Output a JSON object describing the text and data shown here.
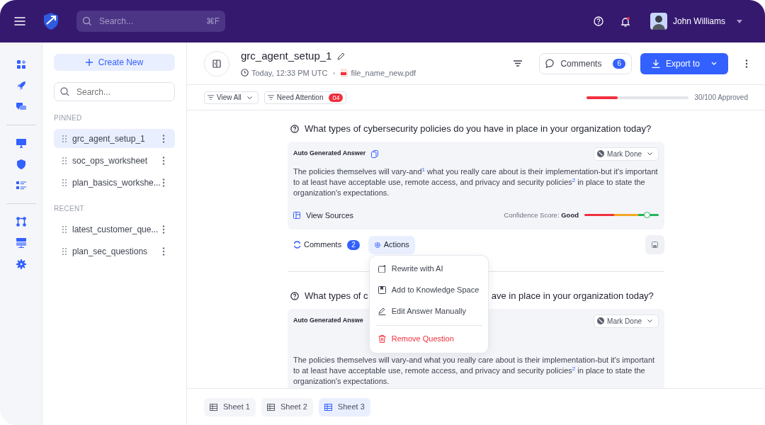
{
  "topbar": {
    "search": {
      "placeholder": "Search...",
      "shortcut": "⌘F"
    },
    "notifications": {
      "unread": true
    },
    "user": {
      "name": "John Williams"
    }
  },
  "sidebar": {
    "create_button": "Create New",
    "search": {
      "placeholder": "Search..."
    },
    "sections": [
      {
        "title": "PINNED",
        "items": [
          {
            "label": "grc_agent_setup_1",
            "selected": true
          },
          {
            "label": "soc_ops_worksheet",
            "selected": false
          },
          {
            "label": "plan_basics_workshe...",
            "selected": false
          }
        ]
      },
      {
        "title": "RECENT",
        "items": [
          {
            "label": "latest_customer_que...",
            "selected": false
          },
          {
            "label": "plan_sec_questions",
            "selected": false
          }
        ]
      }
    ]
  },
  "document": {
    "title": "grc_agent_setup_1",
    "timestamp": "Today, 12:33 PM UTC",
    "file_name": "file_name_new.pdf",
    "comments_button": {
      "label": "Comments",
      "count": "6"
    },
    "export_button": "Export to"
  },
  "filters": [
    {
      "kind": "dropdown",
      "label": "View All"
    },
    {
      "kind": "count",
      "label": "Need Attention",
      "badge": "04"
    }
  ],
  "progress": {
    "level": 0.3,
    "label": "30/100 Approved"
  },
  "questions": [
    {
      "question": [
        "What types of cybersecurity policies do you have in place in your organization today?"
      ],
      "answer_label": "Auto Generated Answer",
      "copy_icon": true,
      "status": "Mark Done",
      "answer": "The policies themselves will vary-and$^{1}$ what you really care about is their implementation-but it's important to at least have acceptable use, remote access, and privacy and security policies$^{2}$ in place to state the organization's expectations.",
      "footer": {
        "sources": "View Sources",
        "confidence_label": "Confidence Score:",
        "confidence_value": "Good",
        "level": 0.84
      },
      "actions_row": {
        "comments": "Comments",
        "comments_count": "2",
        "actions": "Actions",
        "actions_open": true
      }
    },
    {
      "question": [
        "What types of c",
        "ave in place in your organization today?"
      ],
      "answer_label": "Auto Generated Answe",
      "copy_icon": false,
      "status": "Mark Done",
      "answer": "The policies themselves will vary-and what you really care about is their implementation-but it's important to at least have acceptable use, remote access, and privacy and security policies$^{2}$ in place to state the organization's expectations."
    }
  ],
  "actions_menu": [
    {
      "kind": "ai",
      "label": "Rewrite with AI"
    },
    {
      "kind": "save",
      "label": "Add to Knowledge Space"
    },
    {
      "kind": "edit",
      "label": "Edit Answer Manually"
    },
    {
      "kind": "danger",
      "label": "Remove Question"
    }
  ],
  "sheets": [
    {
      "label": "Sheet 1",
      "selected": false
    },
    {
      "label": "Sheet 2",
      "selected": false
    },
    {
      "label": "Sheet 3",
      "selected": true
    }
  ]
}
